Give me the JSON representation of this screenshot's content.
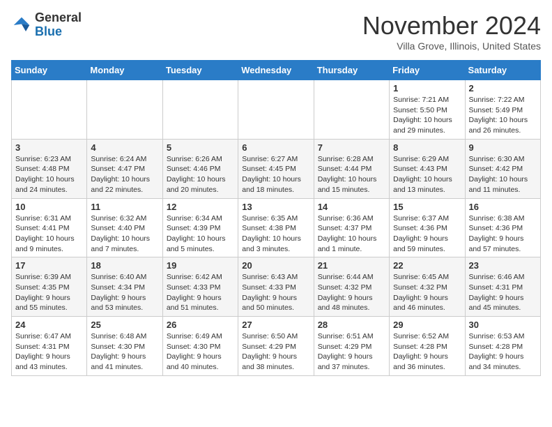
{
  "logo": {
    "general": "General",
    "blue": "Blue"
  },
  "header": {
    "month": "November 2024",
    "location": "Villa Grove, Illinois, United States"
  },
  "days_of_week": [
    "Sunday",
    "Monday",
    "Tuesday",
    "Wednesday",
    "Thursday",
    "Friday",
    "Saturday"
  ],
  "weeks": [
    [
      {
        "day": "",
        "info": ""
      },
      {
        "day": "",
        "info": ""
      },
      {
        "day": "",
        "info": ""
      },
      {
        "day": "",
        "info": ""
      },
      {
        "day": "",
        "info": ""
      },
      {
        "day": "1",
        "info": "Sunrise: 7:21 AM\nSunset: 5:50 PM\nDaylight: 10 hours and 29 minutes."
      },
      {
        "day": "2",
        "info": "Sunrise: 7:22 AM\nSunset: 5:49 PM\nDaylight: 10 hours and 26 minutes."
      }
    ],
    [
      {
        "day": "3",
        "info": "Sunrise: 6:23 AM\nSunset: 4:48 PM\nDaylight: 10 hours and 24 minutes."
      },
      {
        "day": "4",
        "info": "Sunrise: 6:24 AM\nSunset: 4:47 PM\nDaylight: 10 hours and 22 minutes."
      },
      {
        "day": "5",
        "info": "Sunrise: 6:26 AM\nSunset: 4:46 PM\nDaylight: 10 hours and 20 minutes."
      },
      {
        "day": "6",
        "info": "Sunrise: 6:27 AM\nSunset: 4:45 PM\nDaylight: 10 hours and 18 minutes."
      },
      {
        "day": "7",
        "info": "Sunrise: 6:28 AM\nSunset: 4:44 PM\nDaylight: 10 hours and 15 minutes."
      },
      {
        "day": "8",
        "info": "Sunrise: 6:29 AM\nSunset: 4:43 PM\nDaylight: 10 hours and 13 minutes."
      },
      {
        "day": "9",
        "info": "Sunrise: 6:30 AM\nSunset: 4:42 PM\nDaylight: 10 hours and 11 minutes."
      }
    ],
    [
      {
        "day": "10",
        "info": "Sunrise: 6:31 AM\nSunset: 4:41 PM\nDaylight: 10 hours and 9 minutes."
      },
      {
        "day": "11",
        "info": "Sunrise: 6:32 AM\nSunset: 4:40 PM\nDaylight: 10 hours and 7 minutes."
      },
      {
        "day": "12",
        "info": "Sunrise: 6:34 AM\nSunset: 4:39 PM\nDaylight: 10 hours and 5 minutes."
      },
      {
        "day": "13",
        "info": "Sunrise: 6:35 AM\nSunset: 4:38 PM\nDaylight: 10 hours and 3 minutes."
      },
      {
        "day": "14",
        "info": "Sunrise: 6:36 AM\nSunset: 4:37 PM\nDaylight: 10 hours and 1 minute."
      },
      {
        "day": "15",
        "info": "Sunrise: 6:37 AM\nSunset: 4:36 PM\nDaylight: 9 hours and 59 minutes."
      },
      {
        "day": "16",
        "info": "Sunrise: 6:38 AM\nSunset: 4:36 PM\nDaylight: 9 hours and 57 minutes."
      }
    ],
    [
      {
        "day": "17",
        "info": "Sunrise: 6:39 AM\nSunset: 4:35 PM\nDaylight: 9 hours and 55 minutes."
      },
      {
        "day": "18",
        "info": "Sunrise: 6:40 AM\nSunset: 4:34 PM\nDaylight: 9 hours and 53 minutes."
      },
      {
        "day": "19",
        "info": "Sunrise: 6:42 AM\nSunset: 4:33 PM\nDaylight: 9 hours and 51 minutes."
      },
      {
        "day": "20",
        "info": "Sunrise: 6:43 AM\nSunset: 4:33 PM\nDaylight: 9 hours and 50 minutes."
      },
      {
        "day": "21",
        "info": "Sunrise: 6:44 AM\nSunset: 4:32 PM\nDaylight: 9 hours and 48 minutes."
      },
      {
        "day": "22",
        "info": "Sunrise: 6:45 AM\nSunset: 4:32 PM\nDaylight: 9 hours and 46 minutes."
      },
      {
        "day": "23",
        "info": "Sunrise: 6:46 AM\nSunset: 4:31 PM\nDaylight: 9 hours and 45 minutes."
      }
    ],
    [
      {
        "day": "24",
        "info": "Sunrise: 6:47 AM\nSunset: 4:31 PM\nDaylight: 9 hours and 43 minutes."
      },
      {
        "day": "25",
        "info": "Sunrise: 6:48 AM\nSunset: 4:30 PM\nDaylight: 9 hours and 41 minutes."
      },
      {
        "day": "26",
        "info": "Sunrise: 6:49 AM\nSunset: 4:30 PM\nDaylight: 9 hours and 40 minutes."
      },
      {
        "day": "27",
        "info": "Sunrise: 6:50 AM\nSunset: 4:29 PM\nDaylight: 9 hours and 38 minutes."
      },
      {
        "day": "28",
        "info": "Sunrise: 6:51 AM\nSunset: 4:29 PM\nDaylight: 9 hours and 37 minutes."
      },
      {
        "day": "29",
        "info": "Sunrise: 6:52 AM\nSunset: 4:28 PM\nDaylight: 9 hours and 36 minutes."
      },
      {
        "day": "30",
        "info": "Sunrise: 6:53 AM\nSunset: 4:28 PM\nDaylight: 9 hours and 34 minutes."
      }
    ]
  ]
}
